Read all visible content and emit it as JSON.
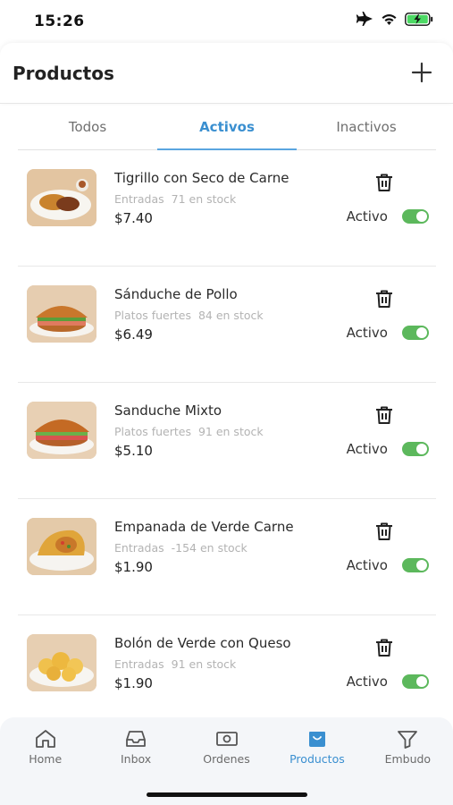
{
  "status_bar": {
    "time": "15:26",
    "icons": [
      "airplane-icon",
      "wifi-icon",
      "battery-charging-icon"
    ]
  },
  "header": {
    "title": "Productos",
    "add_icon": "plus-icon"
  },
  "tabs": [
    {
      "label": "Todos",
      "active": false
    },
    {
      "label": "Activos",
      "active": true
    },
    {
      "label": "Inactivos",
      "active": false
    }
  ],
  "products": [
    {
      "name": "Tigrillo con Seco de Carne",
      "category": "Entradas",
      "stock": "71 en stock",
      "price": "$7.40",
      "status": "Activo",
      "active": true
    },
    {
      "name": "Sánduche de Pollo",
      "category": "Platos fuertes",
      "stock": "84 en stock",
      "price": "$6.49",
      "status": "Activo",
      "active": true
    },
    {
      "name": "Sanduche Mixto",
      "category": "Platos fuertes",
      "stock": "91 en stock",
      "price": "$5.10",
      "status": "Activo",
      "active": true
    },
    {
      "name": "Empanada de Verde Carne",
      "category": "Entradas",
      "stock": "-154 en stock",
      "price": "$1.90",
      "status": "Activo",
      "active": true
    },
    {
      "name": "Bolón de Verde con Queso",
      "category": "Entradas",
      "stock": "91 en stock",
      "price": "$1.90",
      "status": "Activo",
      "active": true
    }
  ],
  "bottom_nav": [
    {
      "label": "Home",
      "icon": "home-icon",
      "active": false
    },
    {
      "label": "Inbox",
      "icon": "inbox-icon",
      "active": false
    },
    {
      "label": "Ordenes",
      "icon": "money-icon",
      "active": false
    },
    {
      "label": "Productos",
      "icon": "shopping-bag-icon",
      "active": true
    },
    {
      "label": "Embudo",
      "icon": "funnel-icon",
      "active": false
    }
  ],
  "colors": {
    "accent": "#3a8fd0",
    "toggle_on": "#5cb85c",
    "muted_text": "#b3b3b3"
  }
}
